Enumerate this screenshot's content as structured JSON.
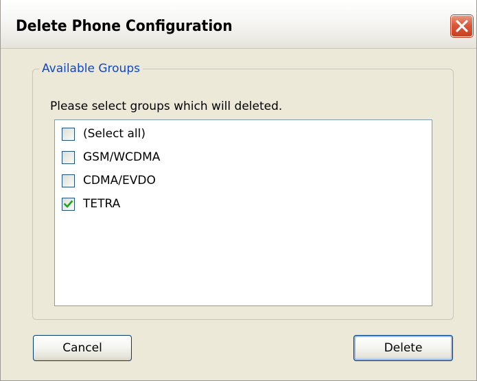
{
  "window": {
    "title": "Delete Phone Configuration"
  },
  "groupbox": {
    "legend": "Available Groups",
    "prompt": "Please select groups which will deleted."
  },
  "list": {
    "items": [
      {
        "label": "(Select all)",
        "checked": false
      },
      {
        "label": "GSM/WCDMA",
        "checked": false
      },
      {
        "label": "CDMA/EVDO",
        "checked": false
      },
      {
        "label": "TETRA",
        "checked": true
      }
    ]
  },
  "buttons": {
    "cancel_label": "Cancel",
    "delete_label": "Delete"
  },
  "icons": {
    "close": "close-icon",
    "check": "checkmark-icon"
  },
  "colors": {
    "legend_text": "#1046c9",
    "close_button": "#d9583b",
    "checkmark": "#21a121",
    "dialog_background": "#ece9d8"
  }
}
